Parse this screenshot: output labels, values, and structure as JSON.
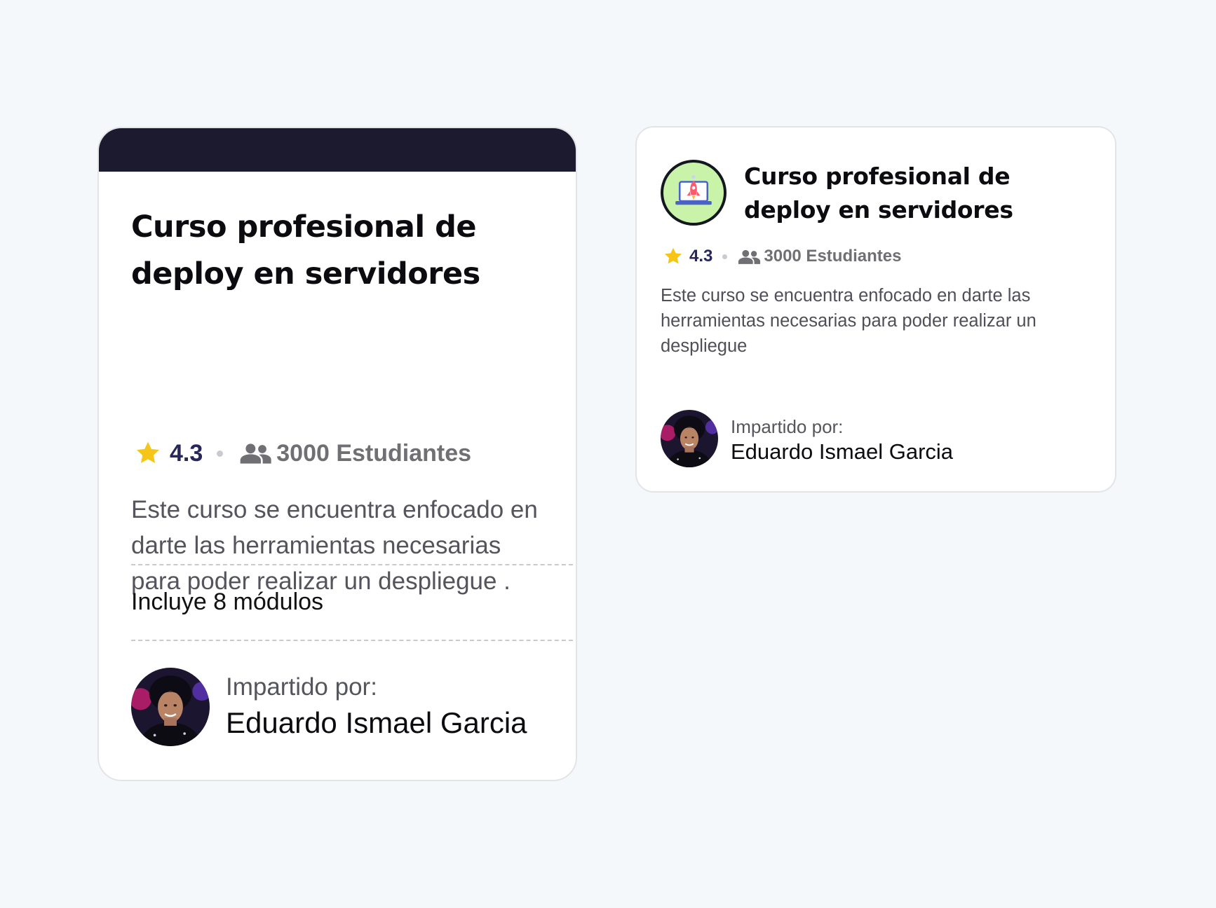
{
  "colors": {
    "page_background": "#f5f8fb",
    "card_background": "#ffffff",
    "card_border": "#e2e4e8",
    "banner": "#1b1a2e",
    "rating_text": "#27275a",
    "star": "#f5c518",
    "muted_text": "#707074",
    "icon_background": "#c8f3a8"
  },
  "card_large": {
    "title": "Curso profesional de deploy en servidores",
    "rating": "4.3",
    "students": "3000 Estudiantes",
    "description": "Este curso se encuentra enfocado en darte las herramientas necesarias para poder realizar un despliegue .",
    "modules": "Incluye 8 módulos",
    "taught_by_label": "Impartido por:",
    "instructor_name": "Eduardo Ismael Garcia",
    "icons": [
      "star-icon",
      "people-icon",
      "instructor-avatar"
    ]
  },
  "card_compact": {
    "title": "Curso profesional de deploy en servidores",
    "rating": "4.3",
    "students": "3000 Estudiantes",
    "description": "Este curso se encuentra enfocado en darte las herramientas necesarias para poder realizar un despliegue",
    "taught_by_label": "Impartido por:",
    "instructor_name": "Eduardo Ismael Garcia",
    "icons": [
      "rocket-laptop-icon",
      "star-icon",
      "people-icon",
      "instructor-avatar"
    ]
  }
}
